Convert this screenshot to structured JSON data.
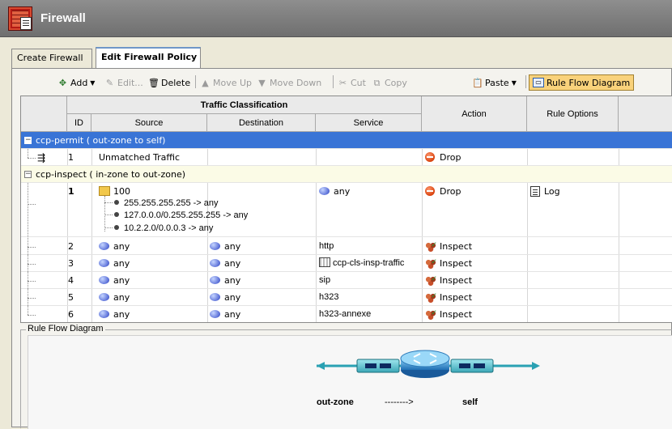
{
  "app": {
    "title": "Firewall",
    "icon": "firewall-icon"
  },
  "tabs": [
    {
      "label": "Create Firewall",
      "active": false
    },
    {
      "label": "Edit Firewall Policy",
      "active": true
    }
  ],
  "toolbar": {
    "add": "Add",
    "edit": "Edit...",
    "delete": "Delete",
    "move_up": "Move Up",
    "move_down": "Move Down",
    "cut": "Cut",
    "copy": "Copy",
    "paste": "Paste",
    "rule_flow": "Rule Flow Diagram"
  },
  "table": {
    "group_header": "Traffic Classification",
    "columns": {
      "id": "ID",
      "source": "Source",
      "destination": "Destination",
      "service": "Service",
      "action": "Action",
      "rule_options": "Rule Options"
    }
  },
  "groups": [
    {
      "label": "ccp-permit ( out-zone to self)",
      "rules": [
        {
          "id": "1",
          "source": "Unmatched Traffic",
          "destination": "",
          "service": "",
          "action": "Drop",
          "options": ""
        }
      ]
    },
    {
      "label": "ccp-inspect ( in-zone to out-zone)",
      "rules": [
        {
          "id": "1",
          "source": "100",
          "destination": "",
          "service": "any",
          "action": "Drop",
          "options": "Log",
          "source_items": [
            "255.255.255.255 -> any",
            "127.0.0.0/0.255.255.255 -> any",
            "10.2.2.0/0.0.0.3 -> any"
          ]
        },
        {
          "id": "2",
          "source": "any",
          "destination": "any",
          "service": "http",
          "action": "Inspect",
          "options": ""
        },
        {
          "id": "3",
          "source": "any",
          "destination": "any",
          "service": "ccp-cls-insp-traffic",
          "action": "Inspect",
          "options": ""
        },
        {
          "id": "4",
          "source": "any",
          "destination": "any",
          "service": "sip",
          "action": "Inspect",
          "options": ""
        },
        {
          "id": "5",
          "source": "any",
          "destination": "any",
          "service": "h323",
          "action": "Inspect",
          "options": ""
        },
        {
          "id": "6",
          "source": "any",
          "destination": "any",
          "service": "h323-annexe",
          "action": "Inspect",
          "options": ""
        }
      ]
    }
  ],
  "flow": {
    "label": "Rule Flow Diagram",
    "from_zone": "out-zone",
    "arrow": "-------->",
    "to_zone": "self"
  },
  "colors": {
    "selected_group": "#3974d6",
    "group_highlight": "#fbfbe6",
    "title_bar": "#7a7a7a"
  }
}
